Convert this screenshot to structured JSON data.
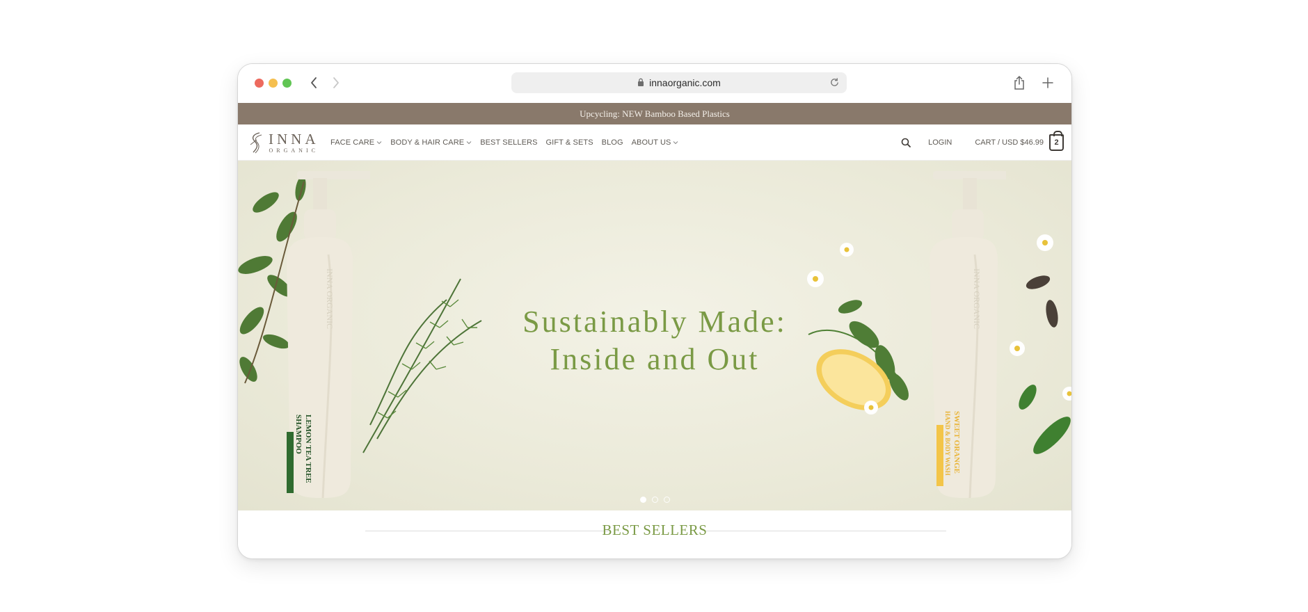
{
  "browser": {
    "url": "innaorganic.com",
    "icons": [
      "back-icon",
      "forward-icon",
      "lock-icon",
      "reload-icon",
      "share-icon",
      "new-tab-icon"
    ]
  },
  "announcement": "Upcycling: NEW Bamboo Based Plastics",
  "site": {
    "logo_word": "INNA",
    "logo_sub": "ORGANIC",
    "nav": [
      {
        "label": "FACE CARE",
        "dropdown": true
      },
      {
        "label": "BODY & HAIR CARE",
        "dropdown": true
      },
      {
        "label": "BEST SELLERS",
        "dropdown": false
      },
      {
        "label": "GIFT & SETS",
        "dropdown": false
      },
      {
        "label": "BLOG",
        "dropdown": false
      },
      {
        "label": "ABOUT US",
        "dropdown": true
      }
    ],
    "login": "LOGIN",
    "cart_label": "CART / USD $46.99",
    "cart_count": "2"
  },
  "hero": {
    "line1": "Sustainably Made:",
    "line2": "Inside and Out",
    "left_product": {
      "brand": "INNA ORGANIC",
      "name_line1": "LEMON TEA TREE",
      "name_line2": "SHAMPOO"
    },
    "right_product": {
      "brand": "INNA ORGANIC",
      "name_line1": "SWEET ORANGE",
      "name_line2": "HAND & BODY WASH"
    },
    "slides": 3,
    "active_slide": 1
  },
  "section_title": "BEST SELLERS",
  "colors": {
    "accent_green": "#7a9a45",
    "announcement_bg": "#89796b",
    "hero_bg": "#ebead9"
  }
}
